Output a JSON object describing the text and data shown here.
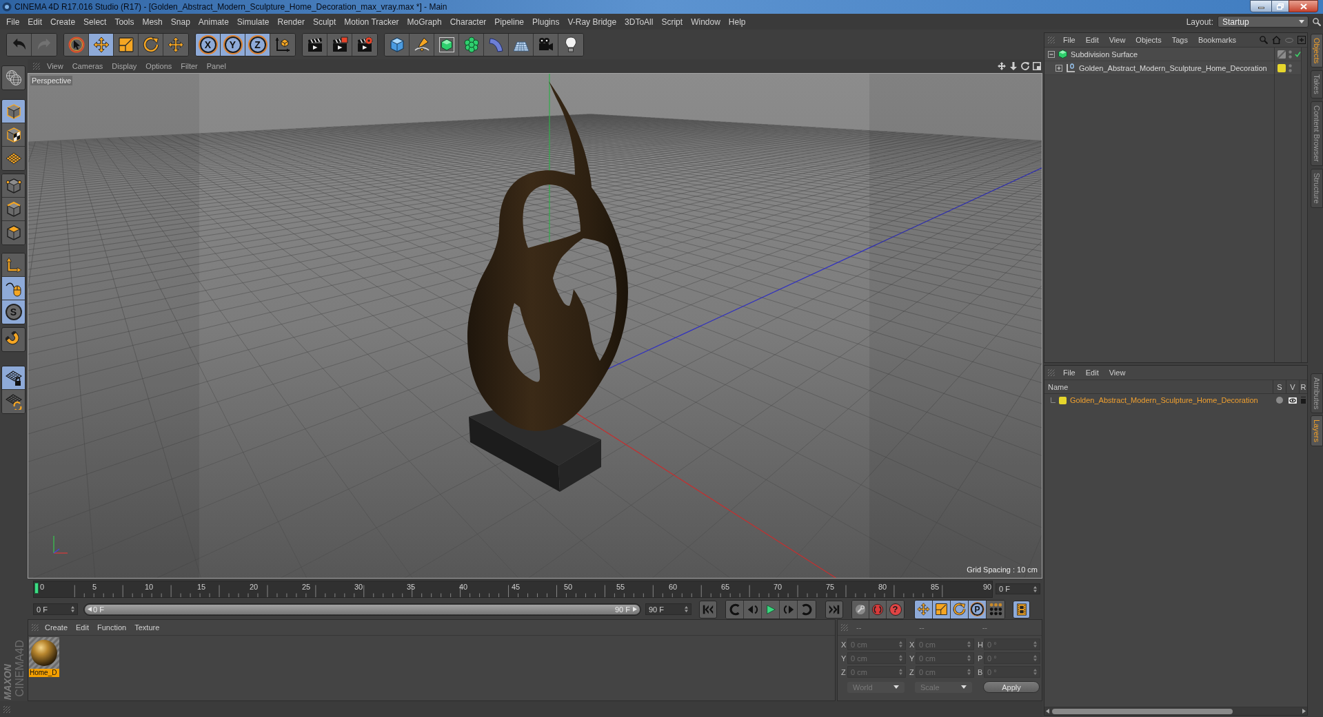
{
  "window": {
    "title": "CINEMA 4D R17.016 Studio (R17) - [Golden_Abstract_Modern_Sculpture_Home_Decoration_max_vray.max *] - Main"
  },
  "menu_bar": {
    "items": [
      "File",
      "Edit",
      "Create",
      "Select",
      "Tools",
      "Mesh",
      "Snap",
      "Animate",
      "Simulate",
      "Render",
      "Sculpt",
      "Motion Tracker",
      "MoGraph",
      "Character",
      "Pipeline",
      "Plugins",
      "V-Ray Bridge",
      "3DToAll",
      "Script",
      "Window",
      "Help"
    ],
    "layout_label": "Layout:",
    "layout_value": "Startup"
  },
  "toolbar": {
    "history": [
      {
        "disabled": false
      },
      {
        "disabled": true
      }
    ],
    "tools": [
      {
        "selected": false
      },
      {
        "selected": true
      },
      {
        "selected": false
      },
      {
        "selected": false
      },
      {
        "selected": false
      }
    ],
    "axis_locks": [
      {
        "label": "X",
        "selected": true
      },
      {
        "label": "Y",
        "selected": true
      },
      {
        "label": "Z",
        "selected": true
      }
    ]
  },
  "mode_toolbar": [
    {
      "selected": false
    },
    {
      "selected": true
    },
    {
      "selected": false
    },
    {
      "selected": false
    },
    {
      "selected": false
    },
    {
      "selected": false
    },
    {
      "selected": false
    },
    {
      "selected": false
    },
    {
      "selected": true
    },
    {
      "selected": true,
      "label": "S"
    },
    {
      "selected": false
    },
    {
      "selected": true
    },
    {
      "selected": false
    }
  ],
  "viewport": {
    "menu": [
      "View",
      "Cameras",
      "Display",
      "Options",
      "Filter",
      "Panel"
    ],
    "camera": "Perspective",
    "grid_spacing": "Grid Spacing : 10 cm"
  },
  "timeline": {
    "ticks": [
      "0",
      "5",
      "10",
      "15",
      "20",
      "25",
      "30",
      "35",
      "40",
      "45",
      "50",
      "55",
      "60",
      "65",
      "70",
      "75",
      "80",
      "85",
      "90"
    ],
    "current_frame": "0 F",
    "start_field": "0 F",
    "range": {
      "start": "0 F",
      "end": "90 F",
      "level": 1
    },
    "end_field": "90 F",
    "record_help": "?",
    "key_tracks": [
      {
        "selected": true
      },
      {
        "selected": true
      },
      {
        "selected": true
      },
      {
        "selected": true,
        "label": "P"
      },
      {
        "selected": false
      }
    ],
    "timeline_toggle": {
      "selected": true
    }
  },
  "material_manager": {
    "menu": [
      "Create",
      "Edit",
      "Function",
      "Texture"
    ],
    "materials": [
      {
        "name": "Home_D",
        "selected": true
      }
    ]
  },
  "coordinates": {
    "disabled": true,
    "headers": [
      "--",
      "--",
      "--"
    ],
    "rows": [
      [
        {
          "axis": "X",
          "value": "0 cm"
        },
        {
          "axis": "X",
          "value": "0 cm"
        },
        {
          "axis": "H",
          "value": "0 °"
        }
      ],
      [
        {
          "axis": "Y",
          "value": "0 cm"
        },
        {
          "axis": "Y",
          "value": "0 cm"
        },
        {
          "axis": "P",
          "value": "0 °"
        }
      ],
      [
        {
          "axis": "Z",
          "value": "0 cm"
        },
        {
          "axis": "Z",
          "value": "0 cm"
        },
        {
          "axis": "B",
          "value": "0 °"
        }
      ]
    ],
    "space": "World",
    "mode": "Scale",
    "apply": "Apply"
  },
  "objects_panel": {
    "menu": [
      "File",
      "Edit",
      "View",
      "Objects",
      "Tags",
      "Bookmarks"
    ],
    "tree": [
      {
        "kind": "generator",
        "name": "Subdivision Surface",
        "expanded": true,
        "enabled": true,
        "children": [
          {
            "kind": "null",
            "name": "Golden_Abstract_Modern_Sculpture_Home_Decoration",
            "expanded": false,
            "color": "#e6d62c"
          }
        ]
      }
    ]
  },
  "side_tabs": [
    {
      "label": "Objects",
      "selected": true
    },
    {
      "label": "Takes",
      "selected": false
    },
    {
      "label": "Content Browser",
      "selected": false
    },
    {
      "label": "Structure",
      "selected": false
    }
  ],
  "layers_panel": {
    "menu": [
      "File",
      "Edit",
      "View"
    ],
    "columns": [
      "Name",
      "S",
      "V",
      "R"
    ],
    "layers": [
      {
        "name": "Golden_Abstract_Modern_Sculpture_Home_Decoration",
        "color": "#e6d62c"
      }
    ]
  },
  "lower_side_tabs": [
    {
      "label": "Attributes",
      "selected": false
    },
    {
      "label": "Layers",
      "selected": true
    }
  ],
  "logo": {
    "maker": "MAXON",
    "product": "CINEMA4D"
  }
}
